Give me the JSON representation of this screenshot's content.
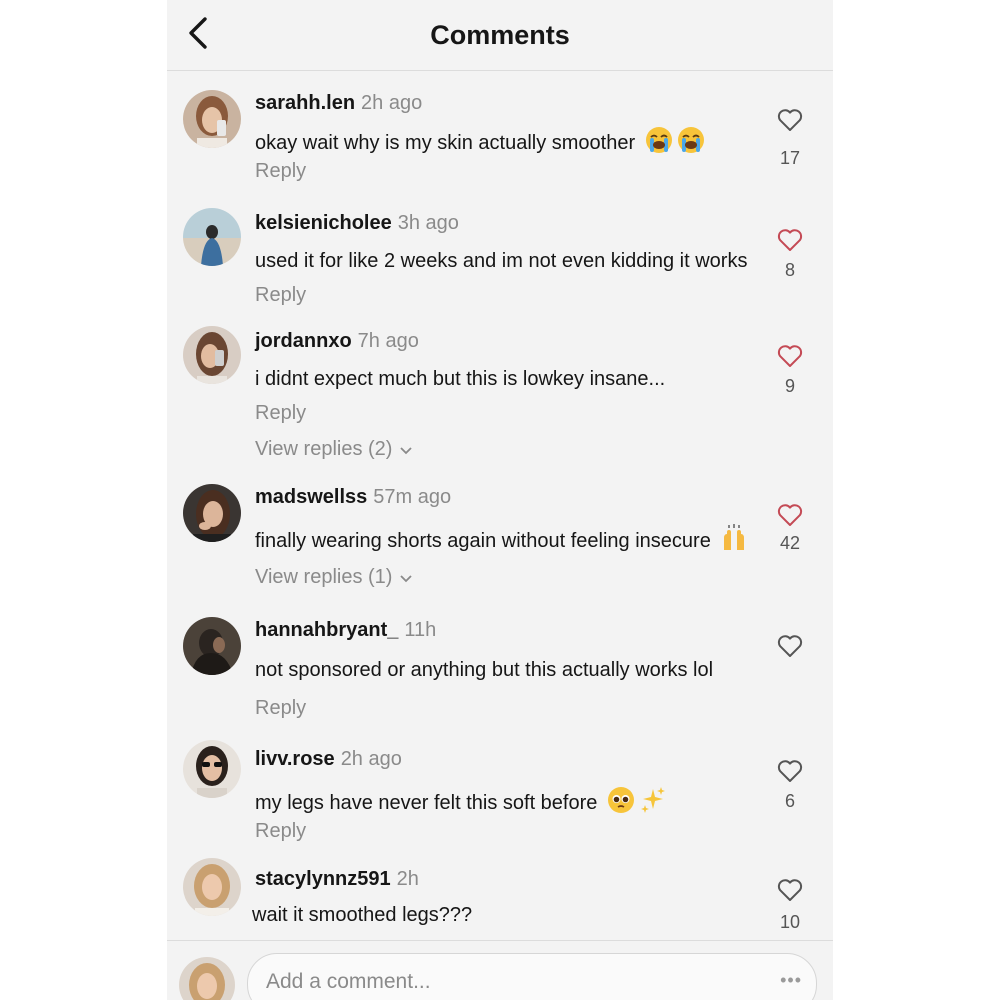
{
  "header": {
    "title": "Comments",
    "back_icon": "chevron-left-icon"
  },
  "colors": {
    "like_active": "#c44a55",
    "like_default": "#555555",
    "meta_gray": "#8a8a8a"
  },
  "comments": [
    {
      "username": "sarahh.len",
      "time": "2h ago",
      "text": "okay wait why is my skin actually smoother",
      "emojis": [
        "loudly-crying-face-icon",
        "loudly-crying-face-icon"
      ],
      "reply_label": "Reply",
      "likes": "17",
      "liked": false
    },
    {
      "username": "kelsienicholee",
      "time": "3h ago",
      "text": "used it for like 2 weeks and im not even kidding it works",
      "emojis": [],
      "reply_label": "Reply",
      "likes": "8",
      "liked": true
    },
    {
      "username": "jordannxo",
      "time": "7h ago",
      "text": "i didnt expect much but this is lowkey insane...",
      "emojis": [],
      "reply_label": "Reply",
      "likes": "9",
      "liked": true,
      "view_replies": "View replies (2)"
    },
    {
      "username": "madswellss",
      "time": "57m ago",
      "text": "finally wearing shorts again without feeling insecure",
      "emojis": [
        "raising-hands-icon"
      ],
      "likes": "42",
      "liked": true,
      "view_replies": "View replies (1)"
    },
    {
      "username": "hannahbryant_",
      "time": "11h",
      "text": "not sponsored or anything but this actually works lol",
      "emojis": [],
      "reply_label": "Reply",
      "likes": "",
      "liked": false
    },
    {
      "username": "livv.rose",
      "time": "2h ago",
      "text": "my legs have never felt this soft before",
      "emojis": [
        "pleading-face-icon",
        "sparkles-icon"
      ],
      "reply_label": "Reply",
      "likes": "6",
      "liked": false
    },
    {
      "username": "stacylynnz591",
      "time": "2h",
      "text": "wait it smoothed legs???",
      "emojis": [],
      "likes": "10",
      "liked": false
    }
  ],
  "footer": {
    "placeholder": "Add a comment...",
    "more": "•••"
  }
}
